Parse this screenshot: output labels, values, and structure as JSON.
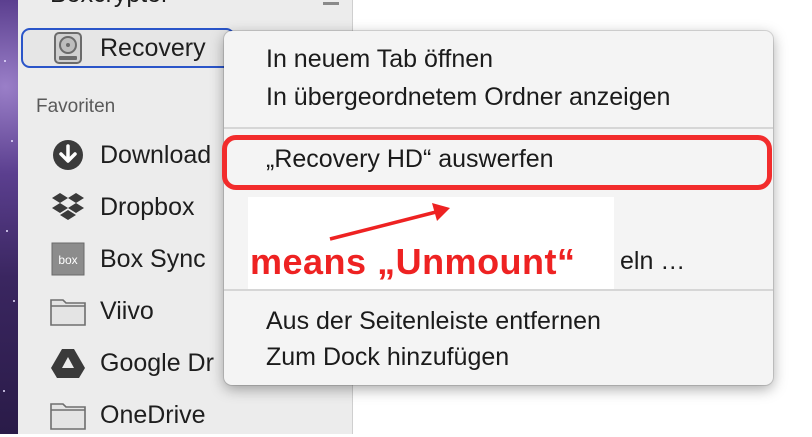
{
  "sidebar": {
    "cut_item": {
      "label": "Boxcryptor"
    },
    "selected_item": {
      "label": "Recovery"
    },
    "section_favorites": "Favoriten",
    "items": [
      {
        "label": "Download",
        "icon": "download-icon"
      },
      {
        "label": "Dropbox",
        "icon": "dropbox-icon"
      },
      {
        "label": "Box Sync",
        "icon": "box-sync-icon"
      },
      {
        "label": "Viivo",
        "icon": "folder-icon"
      },
      {
        "label": "Google Dr",
        "icon": "google-drive-icon"
      },
      {
        "label": "OneDrive",
        "icon": "folder-icon"
      }
    ]
  },
  "context_menu": {
    "items": [
      {
        "label": "In neuem Tab öffnen"
      },
      {
        "label": "In übergeordnetem Ordner anzeigen"
      },
      {
        "label": "„Recovery HD“ auswerfen"
      },
      {
        "label": "eln …"
      },
      {
        "label": "Aus der Seitenleiste entfernen"
      },
      {
        "label": "Zum Dock hinzufügen"
      }
    ]
  },
  "annotation": {
    "text": "means „Unmount“",
    "color": "#ee2222"
  }
}
